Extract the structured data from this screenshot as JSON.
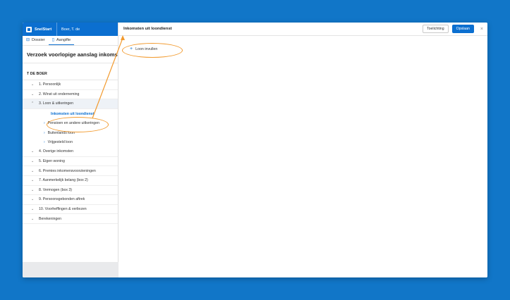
{
  "app": {
    "brand": "SnelStart",
    "user": "Boer, T. de"
  },
  "tabs": [
    {
      "label": "Dossier",
      "icon": "folder-icon",
      "active": false
    },
    {
      "label": "Aangifte",
      "icon": "document-icon",
      "active": true
    }
  ],
  "form_title": "Verzoek voorlopige aanslag inkomsten",
  "client_name": "T DE BOER",
  "nav": {
    "items": [
      {
        "label": "1. Persoonlijk"
      },
      {
        "label": "2. Winst uit onderneming"
      },
      {
        "label": "3. Loon & uitkeringen",
        "open": true
      },
      {
        "label": "4. Overige inkomsten"
      },
      {
        "label": "5. Eigen woning"
      },
      {
        "label": "6. Premies inkomensvoorzieningen"
      },
      {
        "label": "7. Aanmerkelijk belang (box 2)"
      },
      {
        "label": "8. Vermogen (box 3)"
      },
      {
        "label": "9. Persoonsgebonden aftrek"
      },
      {
        "label": "10. Voorheffingen & verliezen"
      },
      {
        "label": "Berekeningen"
      }
    ],
    "sub_items": [
      {
        "label": "Inkomsten uit loondienst",
        "active": true
      },
      {
        "label": "Pensioen en andere uitkeringen"
      },
      {
        "label": "Buitenlands loon"
      },
      {
        "label": "Vrijgesteld loon"
      }
    ]
  },
  "main": {
    "title": "Inkomsten uit loondienst",
    "help_button": "Toelichting",
    "save_button": "Opslaan",
    "close_symbol": "×",
    "add_label": "Loon invullen",
    "add_symbol": "+"
  },
  "colors": {
    "background": "#1176c8",
    "accent": "#0b6fd0",
    "annotation": "#f29a2e"
  }
}
